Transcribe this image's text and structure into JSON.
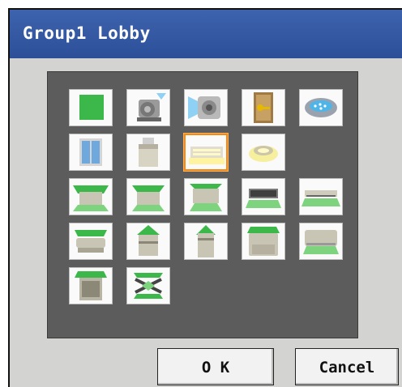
{
  "dialog": {
    "title": "Group1 Lobby",
    "ok_label": "O K",
    "cancel_label": "Cancel"
  },
  "icons": [
    {
      "name": "green-square-icon"
    },
    {
      "name": "pump-icon"
    },
    {
      "name": "fan-blower-icon"
    },
    {
      "name": "door-key-icon"
    },
    {
      "name": "humidifier-icon"
    },
    {
      "name": "window-icon"
    },
    {
      "name": "box-unit-icon"
    },
    {
      "name": "ceiling-light-icon",
      "selected": true
    },
    {
      "name": "downlight-icon"
    },
    {
      "name": "ceiling-cassette-4way-icon"
    },
    {
      "name": "ceiling-cassette-2way-icon"
    },
    {
      "name": "ceiling-cassette-1way-icon"
    },
    {
      "name": "ceiling-concealed-duct-icon"
    },
    {
      "name": "ceiling-slim-duct-icon"
    },
    {
      "name": "ceiling-suspended-icon"
    },
    {
      "name": "floor-standing-up-icon"
    },
    {
      "name": "floor-standing-tall-icon"
    },
    {
      "name": "floor-console-icon"
    },
    {
      "name": "wall-mounted-icon"
    },
    {
      "name": "floor-concealed-icon"
    },
    {
      "name": "heat-exchanger-icon"
    }
  ],
  "colors": {
    "title_bar": "#2c4f98",
    "panel": "#5c5c5c",
    "selection": "#f08a1c",
    "accent_green": "#3cb84a"
  }
}
